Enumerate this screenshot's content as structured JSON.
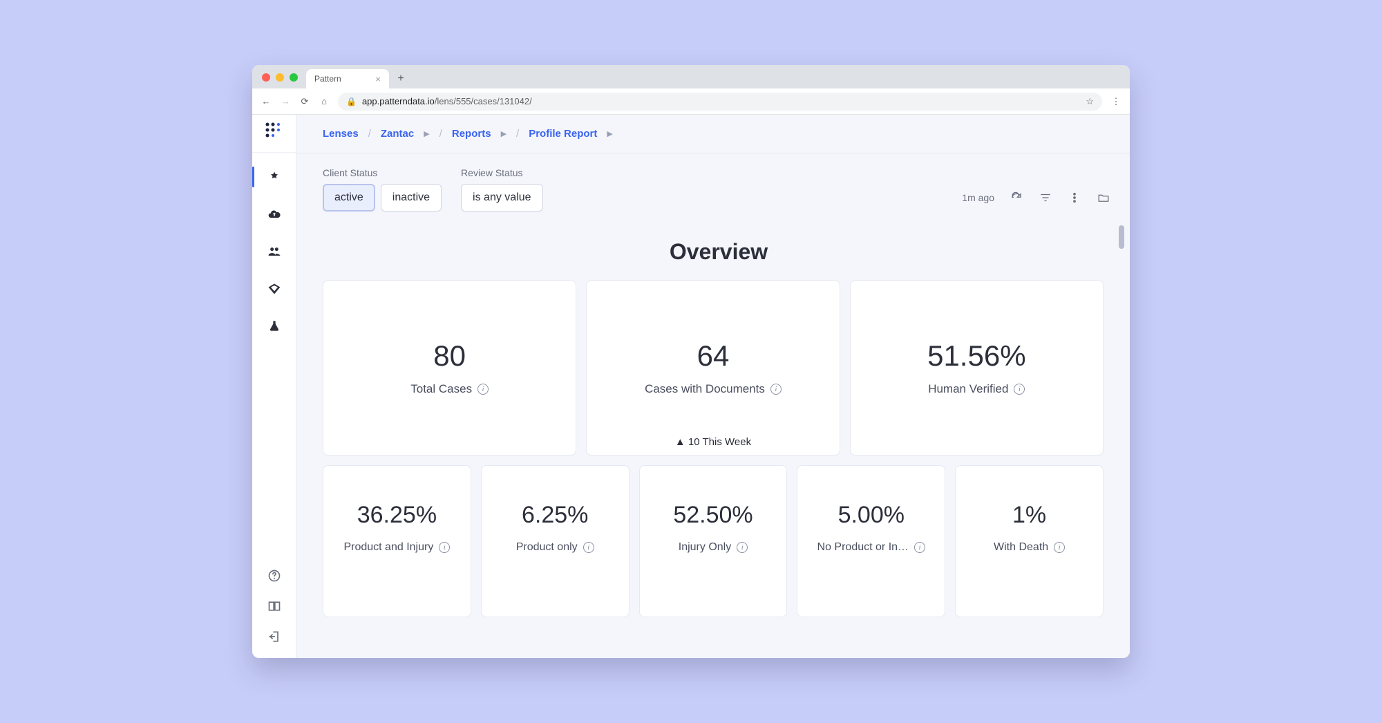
{
  "browser": {
    "tab_title": "Pattern",
    "url_host": "app.patterndata.io",
    "url_path": "/lens/555/cases/131042/"
  },
  "breadcrumbs": {
    "items": [
      "Lenses",
      "Zantac",
      "Reports",
      "Profile Report"
    ]
  },
  "filters": {
    "client_status": {
      "label": "Client Status",
      "options": [
        "active",
        "inactive"
      ],
      "active_index": 0
    },
    "review_status": {
      "label": "Review Status",
      "value": "is any value"
    }
  },
  "toolbar": {
    "updated": "1m ago"
  },
  "overview": {
    "title": "Overview",
    "cards": [
      {
        "value": "80",
        "label": "Total Cases",
        "footer": ""
      },
      {
        "value": "64",
        "label": "Cases with Documents",
        "footer": "▲ 10 This Week"
      },
      {
        "value": "51.56%",
        "label": "Human Verified",
        "footer": ""
      }
    ],
    "row2": [
      {
        "value": "36.25%",
        "label": "Product and Injury"
      },
      {
        "value": "6.25%",
        "label": "Product only"
      },
      {
        "value": "52.50%",
        "label": "Injury Only"
      },
      {
        "value": "5.00%",
        "label": "No Product or In…"
      },
      {
        "value": "1%",
        "label": "With Death"
      }
    ]
  }
}
